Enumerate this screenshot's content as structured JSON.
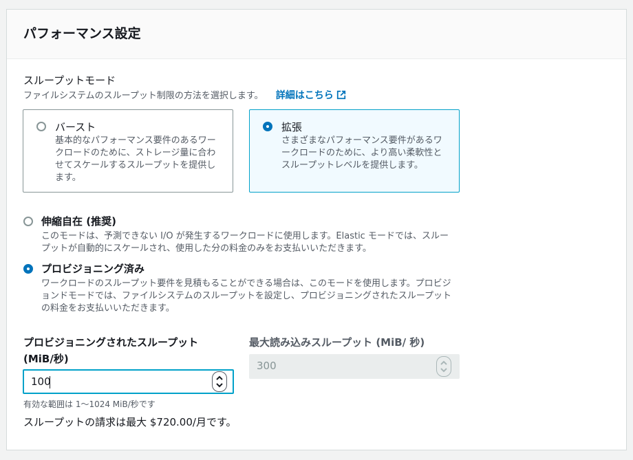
{
  "panel": {
    "title": "パフォーマンス設定"
  },
  "throughput_mode": {
    "label": "スループットモード",
    "description": "ファイルシステムのスループット制限の方法を選択します。",
    "link_label": "詳細はこちら",
    "tiles": [
      {
        "title": "バースト",
        "description": "基本的なパフォーマンス要件のあるワークロードのために、ストレージ量に合わせてスケールするスループットを提供します。",
        "selected": false
      },
      {
        "title": "拡張",
        "description": "さまざまなパフォーマンス要件があるワークロードのために、より高い柔軟性とスループットレベルを提供します。",
        "selected": true
      }
    ]
  },
  "options": [
    {
      "title": "伸縮自在 (推奨)",
      "description": "このモードは、予測できない I/O が発生するワークロードに使用します。Elastic モードでは、スループットが自動的にスケールされ、使用した分の料金のみをお支払いいただきます。",
      "selected": false
    },
    {
      "title": "プロビジョニング済み",
      "description": "ワークロードのスループット要件を見積もることができる場合は、このモードを使用します。プロビジョンドモードでは、ファイルシステムのスループットを設定し、プロビジョニングされたスループットの料金をお支払いいただきます。",
      "selected": true
    }
  ],
  "provisioned": {
    "label_line1": "プロビジョニングされたスループット",
    "label_line2": "(MiB/秒)",
    "value": "100",
    "constraint": "有効な範囲は 1〜1024 MiB/秒です",
    "billing": "スループットの請求は最大 $720.00/月です。"
  },
  "max_read": {
    "label": "最大読み込みスループット (MiB/ 秒)",
    "value": "300"
  },
  "colors": {
    "accent": "#0073bb",
    "selected_border": "#00a1c9",
    "selected_bg": "#f1faff"
  }
}
